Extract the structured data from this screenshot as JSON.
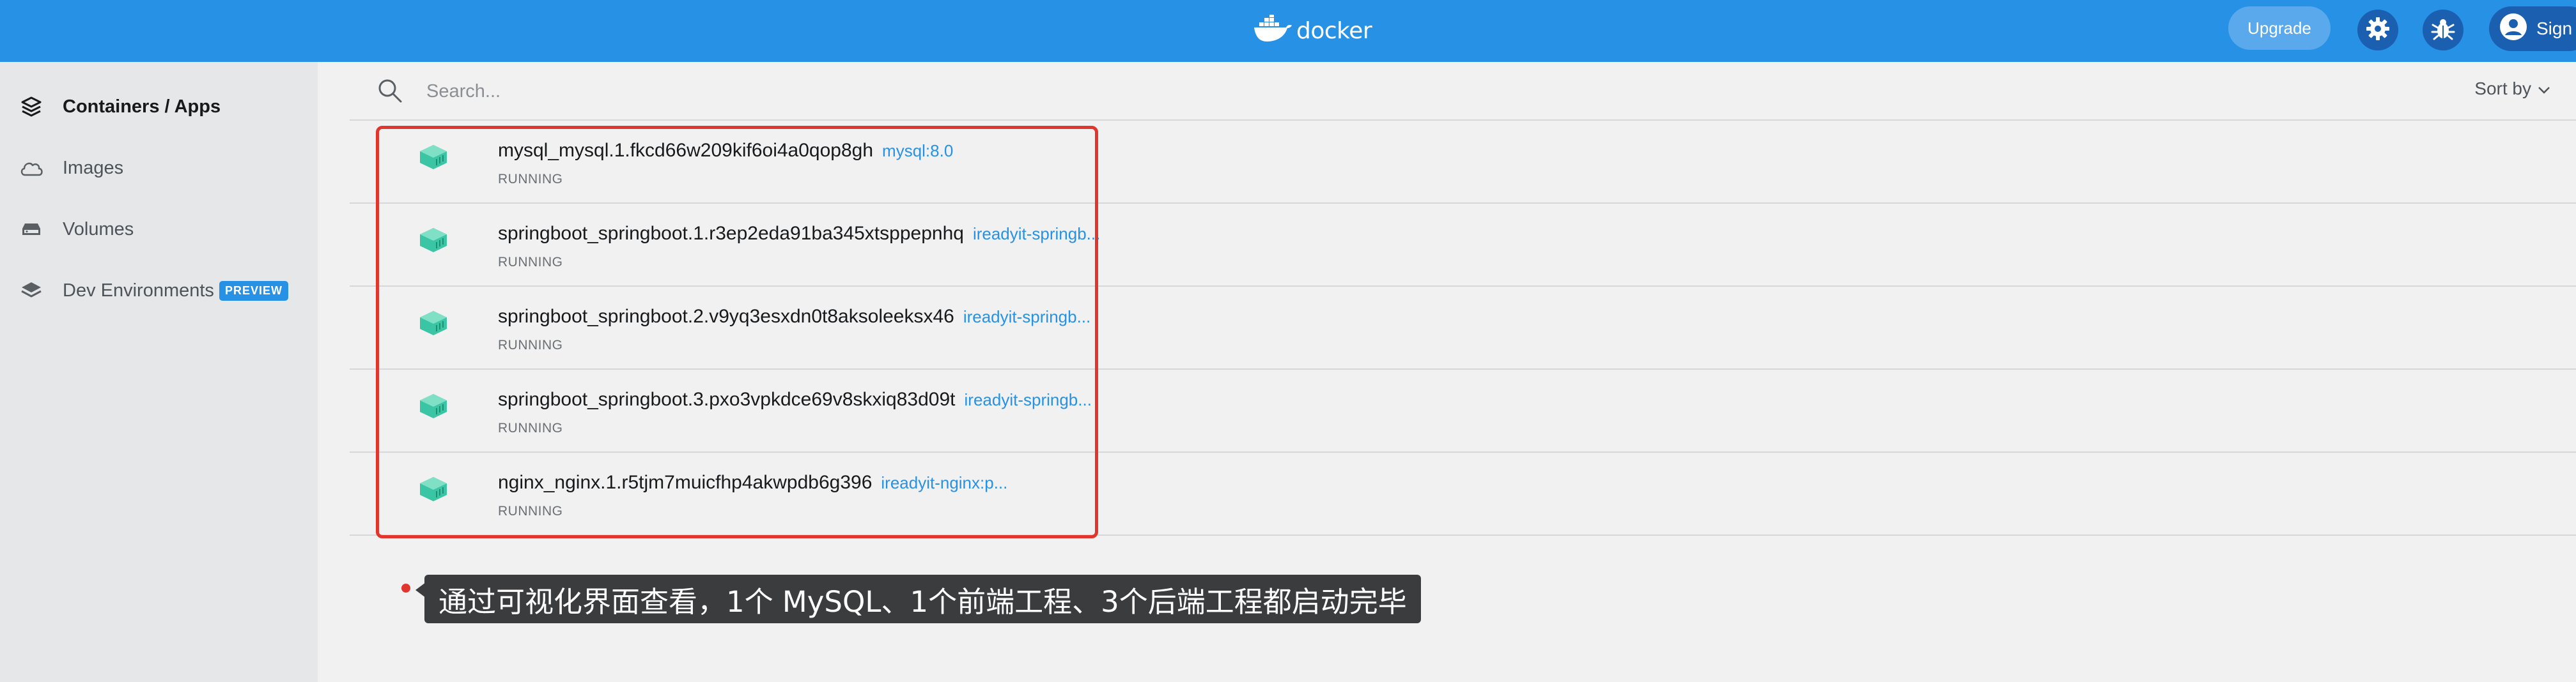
{
  "header": {
    "brand": "docker",
    "upgrade_label": "Upgrade",
    "account_label": "Sign",
    "accent_color": "#2791e6"
  },
  "sidebar": {
    "items": [
      {
        "label": "Containers / Apps",
        "icon": "stack-icon",
        "active": true
      },
      {
        "label": "Images",
        "icon": "cloud-icon",
        "active": false
      },
      {
        "label": "Volumes",
        "icon": "drive-icon",
        "active": false
      },
      {
        "label": "Dev Environments",
        "icon": "layers-icon",
        "active": false,
        "badge": "PREVIEW"
      }
    ]
  },
  "search": {
    "placeholder": "Search...",
    "sort_label": "Sort by"
  },
  "containers": [
    {
      "name": "mysql_mysql.1.fkcd66w209kif6oi4a0qop8gh",
      "image": "mysql:8.0",
      "status": "RUNNING"
    },
    {
      "name": "springboot_springboot.1.r3ep2eda91ba345xtsppepnhq",
      "image": "ireadyit-springb...",
      "status": "RUNNING"
    },
    {
      "name": "springboot_springboot.2.v9yq3esxdn0t8aksoleeksx46",
      "image": "ireadyit-springb...",
      "status": "RUNNING"
    },
    {
      "name": "springboot_springboot.3.pxo3vpkdce69v8skxiq83d09t",
      "image": "ireadyit-springb...",
      "status": "RUNNING"
    },
    {
      "name": "nginx_nginx.1.r5tjm7muicfhp4akwpdb6g396",
      "image": "ireadyit-nginx:p...",
      "status": "RUNNING"
    }
  ],
  "annotation": {
    "caption": "通过可视化界面查看，1个 MySQL、1个前端工程、3个后端工程都启动完毕",
    "highlight_color": "#e0362e"
  }
}
